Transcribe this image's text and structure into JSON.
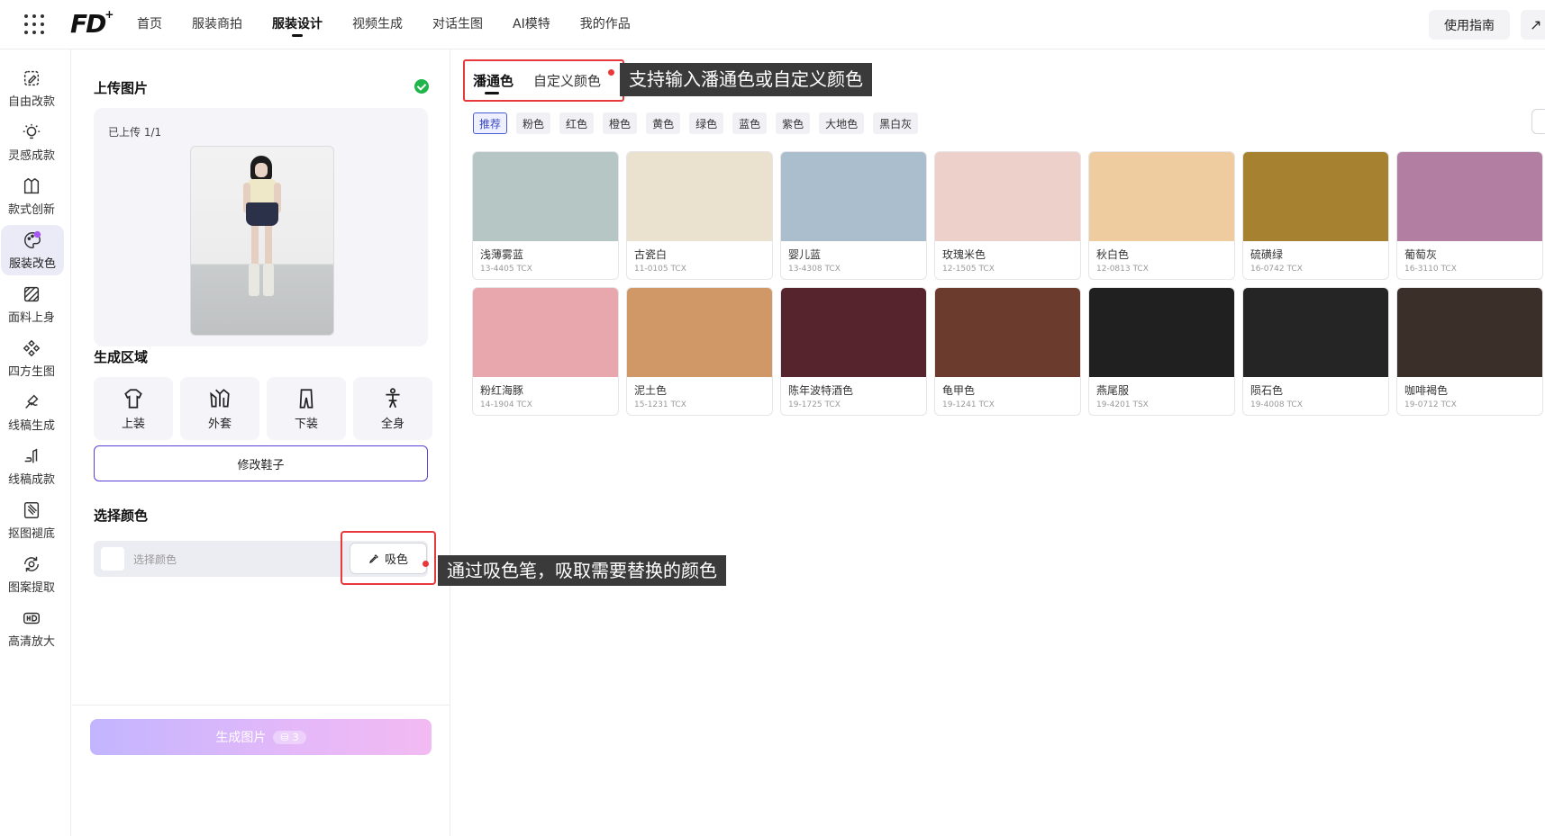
{
  "topbar": {
    "logo_text": "FD",
    "nav": [
      "首页",
      "服装商拍",
      "服装设计",
      "视频生成",
      "对话生图",
      "AI模特",
      "我的作品"
    ],
    "active_nav": "服装设计",
    "guide_label": "使用指南",
    "share_icon": "share-icon"
  },
  "rail": {
    "items": [
      {
        "label": "自由改款",
        "icon": "edit-icon"
      },
      {
        "label": "灵感成款",
        "icon": "bulb-icon"
      },
      {
        "label": "款式创新",
        "icon": "shirt-icon"
      },
      {
        "label": "服装改色",
        "icon": "palette-icon"
      },
      {
        "label": "面料上身",
        "icon": "fabric-icon"
      },
      {
        "label": "四方生图",
        "icon": "pattern-icon"
      },
      {
        "label": "线稿生成",
        "icon": "sketch-icon"
      },
      {
        "label": "线稿成款",
        "icon": "lineart-icon"
      },
      {
        "label": "抠图褪底",
        "icon": "cutout-icon"
      },
      {
        "label": "图案提取",
        "icon": "extract-icon"
      },
      {
        "label": "高清放大",
        "icon": "hd-icon"
      }
    ],
    "active": "服装改色"
  },
  "panel": {
    "upload_title": "上传图片",
    "upload_count": "已上传 1/1",
    "region_title": "生成区域",
    "regions": [
      {
        "label": "上装",
        "icon": "top-garment-icon"
      },
      {
        "label": "外套",
        "icon": "jacket-icon"
      },
      {
        "label": "下装",
        "icon": "pants-icon"
      },
      {
        "label": "全身",
        "icon": "fullbody-icon"
      }
    ],
    "shoe_button": "修改鞋子",
    "color_title": "选择颜色",
    "color_placeholder": "选择颜色",
    "pick_button": "吸色",
    "generate_button": "生成图片",
    "generate_cost": "3"
  },
  "main": {
    "tabs": [
      "潘通色",
      "自定义颜色"
    ],
    "active_tab": "潘通色",
    "callout_top": "支持输入潘通色或自定义颜色",
    "callout_picker": "通过吸色笔，吸取需要替换的颜色",
    "filters": [
      "推荐",
      "粉色",
      "红色",
      "橙色",
      "黄色",
      "绿色",
      "蓝色",
      "紫色",
      "大地色",
      "黑白灰"
    ],
    "active_filter": "推荐",
    "swatches": [
      {
        "name": "浅薄雾蓝",
        "code": "13-4405 TCX",
        "color": "#b5c6c4"
      },
      {
        "name": "古瓷白",
        "code": "11-0105 TCX",
        "color": "#ebe1cf"
      },
      {
        "name": "婴儿蓝",
        "code": "13-4308 TCX",
        "color": "#abbece"
      },
      {
        "name": "玫瑰米色",
        "code": "12-1505 TCX",
        "color": "#eed0ca"
      },
      {
        "name": "秋白色",
        "code": "12-0813 TCX",
        "color": "#efcba0"
      },
      {
        "name": "硫磺绿",
        "code": "16-0742 TCX",
        "color": "#a68230"
      },
      {
        "name": "葡萄灰",
        "code": "16-3110 TCX",
        "color": "#b27ea1"
      },
      {
        "name": "粉红海豚",
        "code": "14-1904 TCX",
        "color": "#e8a6ad"
      },
      {
        "name": "泥土色",
        "code": "15-1231 TCX",
        "color": "#cf9866"
      },
      {
        "name": "陈年波特酒色",
        "code": "19-1725 TCX",
        "color": "#56242c"
      },
      {
        "name": "龟甲色",
        "code": "19-1241 TCX",
        "color": "#6b3b2d"
      },
      {
        "name": "燕尾服",
        "code": "19-4201 TSX",
        "color": "#202021"
      },
      {
        "name": "陨石色",
        "code": "19-4008 TCX",
        "color": "#262526"
      },
      {
        "name": "咖啡褐色",
        "code": "19-0712 TCX",
        "color": "#3a2f29"
      }
    ]
  },
  "colors": {
    "accent": "#5b3fd6",
    "highlight_red": "#e8383b",
    "success": "#1fb54a"
  }
}
